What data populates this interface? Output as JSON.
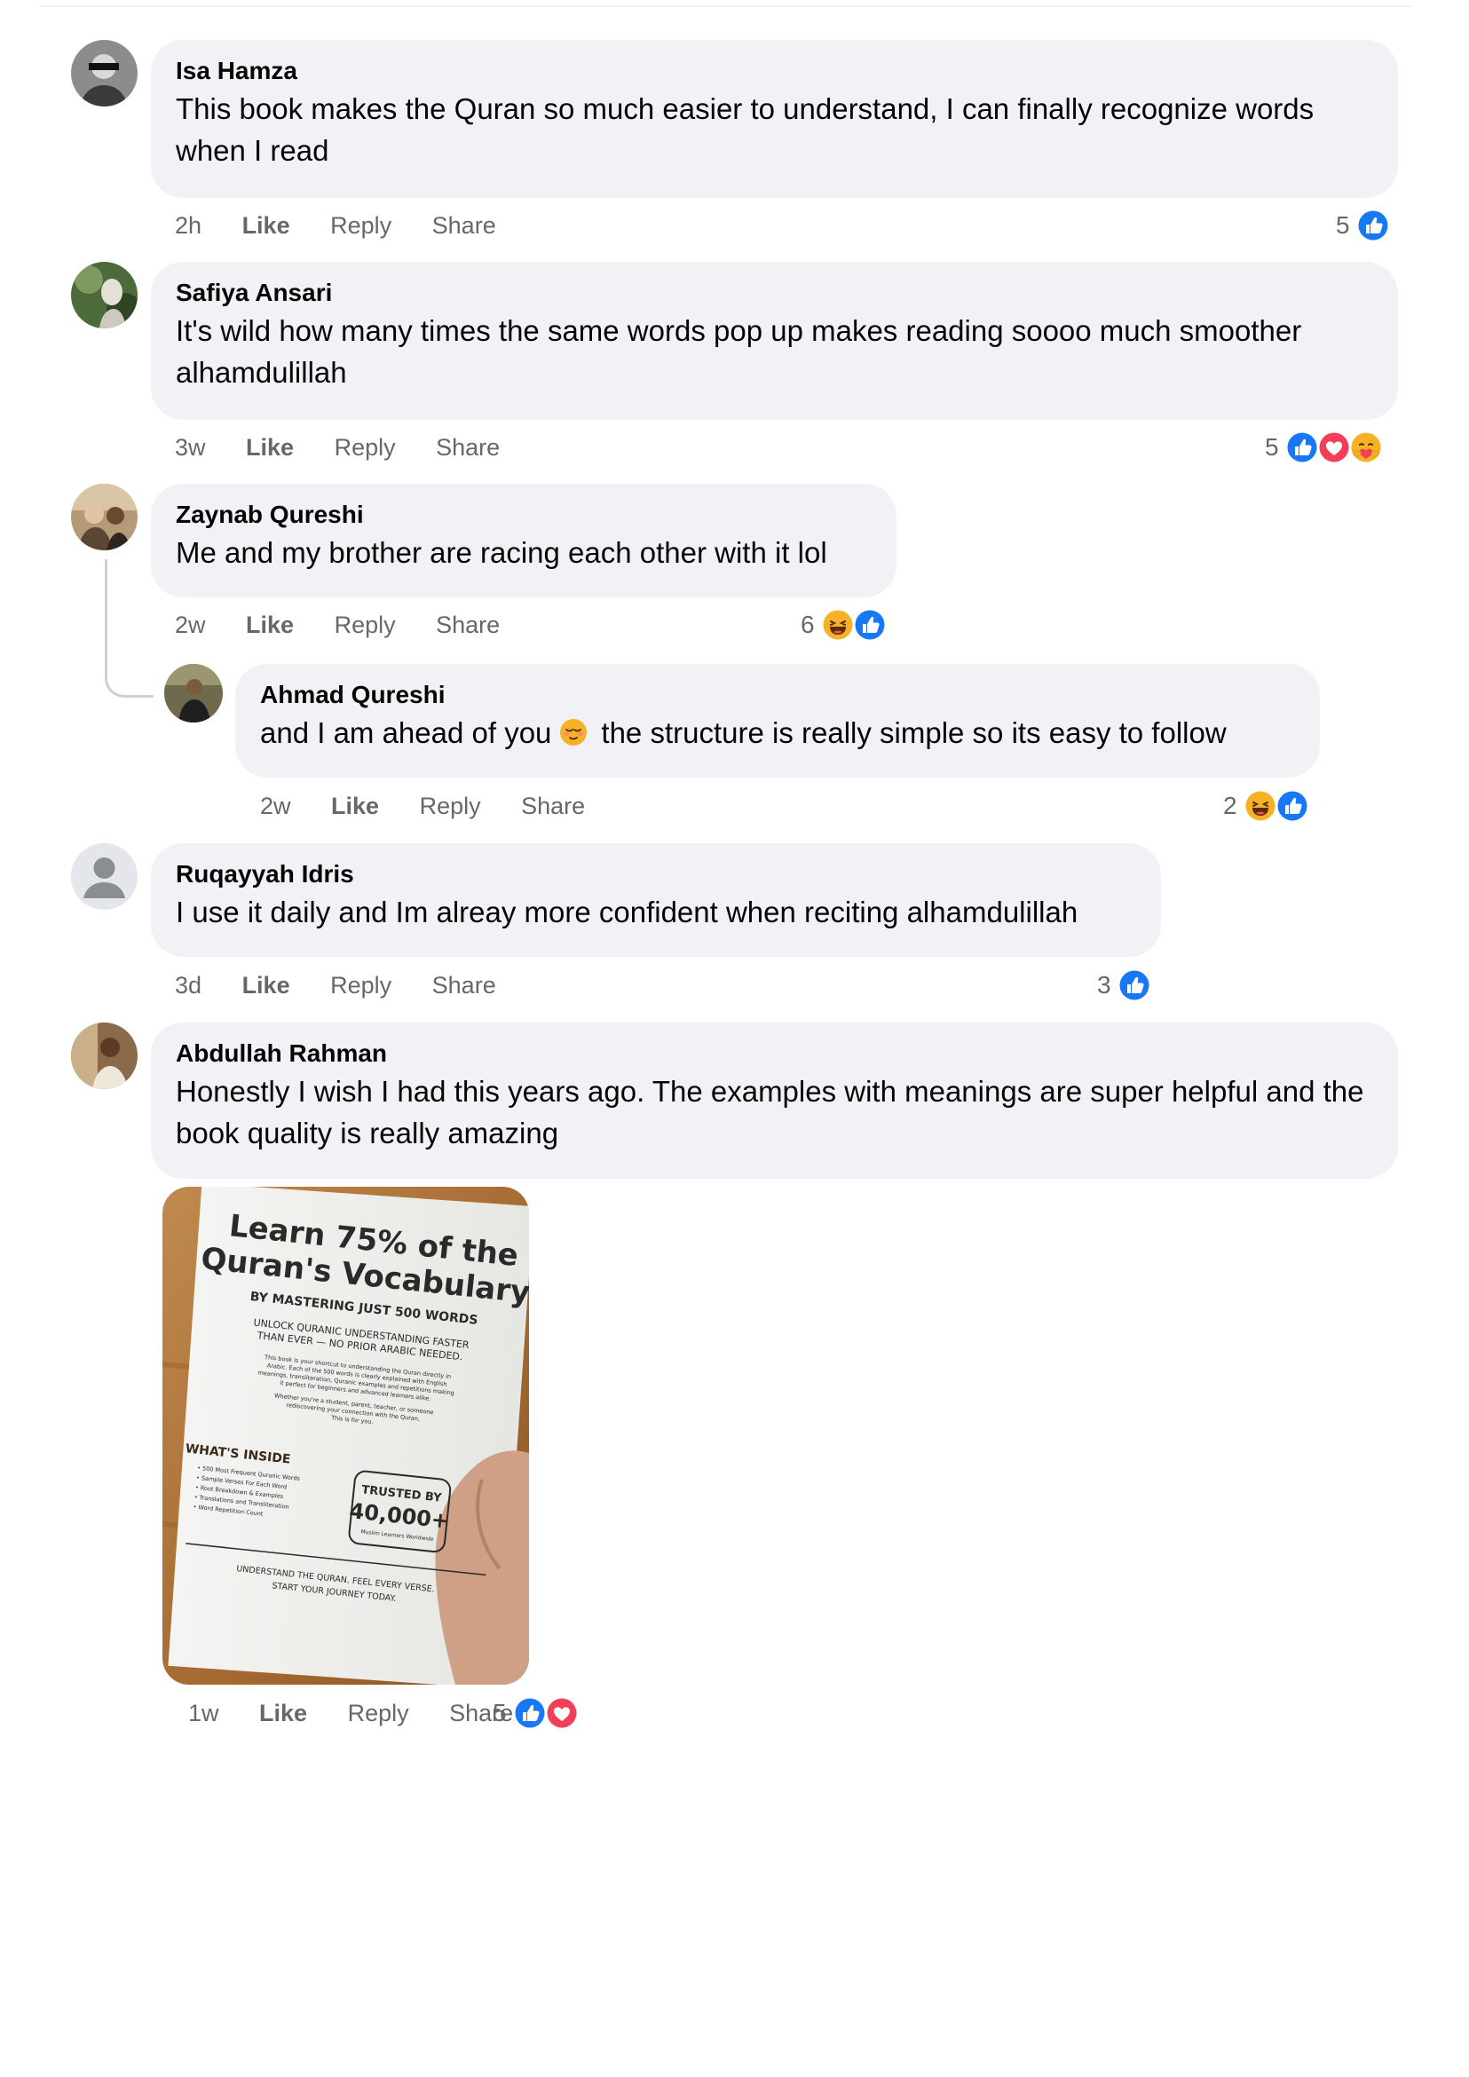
{
  "comments": [
    {
      "author": "Isa Hamza",
      "text": "This book makes the Quran so much easier to understand, I can finally recognize words when I read",
      "time": "2h",
      "like": "Like",
      "reply": "Reply",
      "share": "Share",
      "reaction_count": "5",
      "reactions": [
        "like"
      ]
    },
    {
      "author": "Safiya Ansari",
      "text": "It's wild how many times the same words pop up makes reading soooo much smoother alhamdulillah",
      "time": "3w",
      "like": "Like",
      "reply": "Reply",
      "share": "Share",
      "reaction_count": "5",
      "reactions": [
        "like",
        "love",
        "care"
      ]
    },
    {
      "author": "Zaynab Qureshi",
      "text": "Me and my brother are racing each other with it lol",
      "time": "2w",
      "like": "Like",
      "reply": "Reply",
      "share": "Share",
      "reaction_count": "6",
      "reactions": [
        "haha",
        "like"
      ],
      "replies": [
        {
          "author": "Ahmad Qureshi",
          "text_before": "and I am ahead of you",
          "text_after": "the structure is really simple so its easy to follow",
          "emoji": "relieved-face",
          "time": "2w",
          "like": "Like",
          "reply": "Reply",
          "share": "Share",
          "reaction_count": "2",
          "reactions": [
            "haha",
            "like"
          ]
        }
      ]
    },
    {
      "author": "Ruqayyah Idris",
      "text": "I use it daily and Im alreay more confident when reciting alhamdulillah",
      "time": "3d",
      "like": "Like",
      "reply": "Reply",
      "share": "Share",
      "reaction_count": "3",
      "reactions": [
        "like"
      ]
    },
    {
      "author": "Abdullah Rahman",
      "text": "Honestly I  wish I had this years ago. The examples with meanings are super helpful and the book quality is really amazing",
      "time": "1w",
      "like": "Like",
      "reply": "Reply",
      "share": "Share",
      "reaction_count": "5",
      "reactions": [
        "like",
        "love"
      ],
      "photo": {
        "title_line1": "Learn 75% of the",
        "title_line2": "Quran's Vocabulary",
        "subtitle": "BY MASTERING JUST 500 WORDS",
        "tagline_1": "UNLOCK QURANIC UNDERSTANDING FASTER",
        "tagline_2": "THAN EVER — NO PRIOR ARABIC NEEDED.",
        "body_1": "This book is your shortcut to understanding the Quran directly in",
        "body_2": "Arabic. Each of the 500 words is clearly explained with English",
        "body_3": "meanings, transliteration, Quranic examples and repetitions making",
        "body_4": "it perfect for beginners and advanced learners alike.",
        "body_5": "Whether you're a student, parent, teacher, or someone",
        "body_6": "rediscovering your connection with the Quran,",
        "body_7": "This is for you.",
        "inside_heading": "WHAT'S INSIDE",
        "inside_items": [
          "• 500 Most Frequent Quranic Words",
          "• Sample Verses For Each Word",
          "• Root Breakdown & Examples",
          "• Translations and Transliteration",
          "• Word Repetition Count"
        ],
        "badge_1": "TRUSTED BY",
        "badge_2": "40,000+",
        "badge_3": "Muslim Learners Worldwide",
        "footer_1": "UNDERSTAND THE QURAN. FEEL EVERY VERSE.",
        "footer_2": "START YOUR JOURNEY TODAY."
      }
    }
  ],
  "colors": {
    "bubble": "#f0f2f5",
    "meta": "#65676b",
    "like_blue": "#1877f2",
    "love_red": "#f33e58",
    "haha_yellow": "#f7b125"
  }
}
